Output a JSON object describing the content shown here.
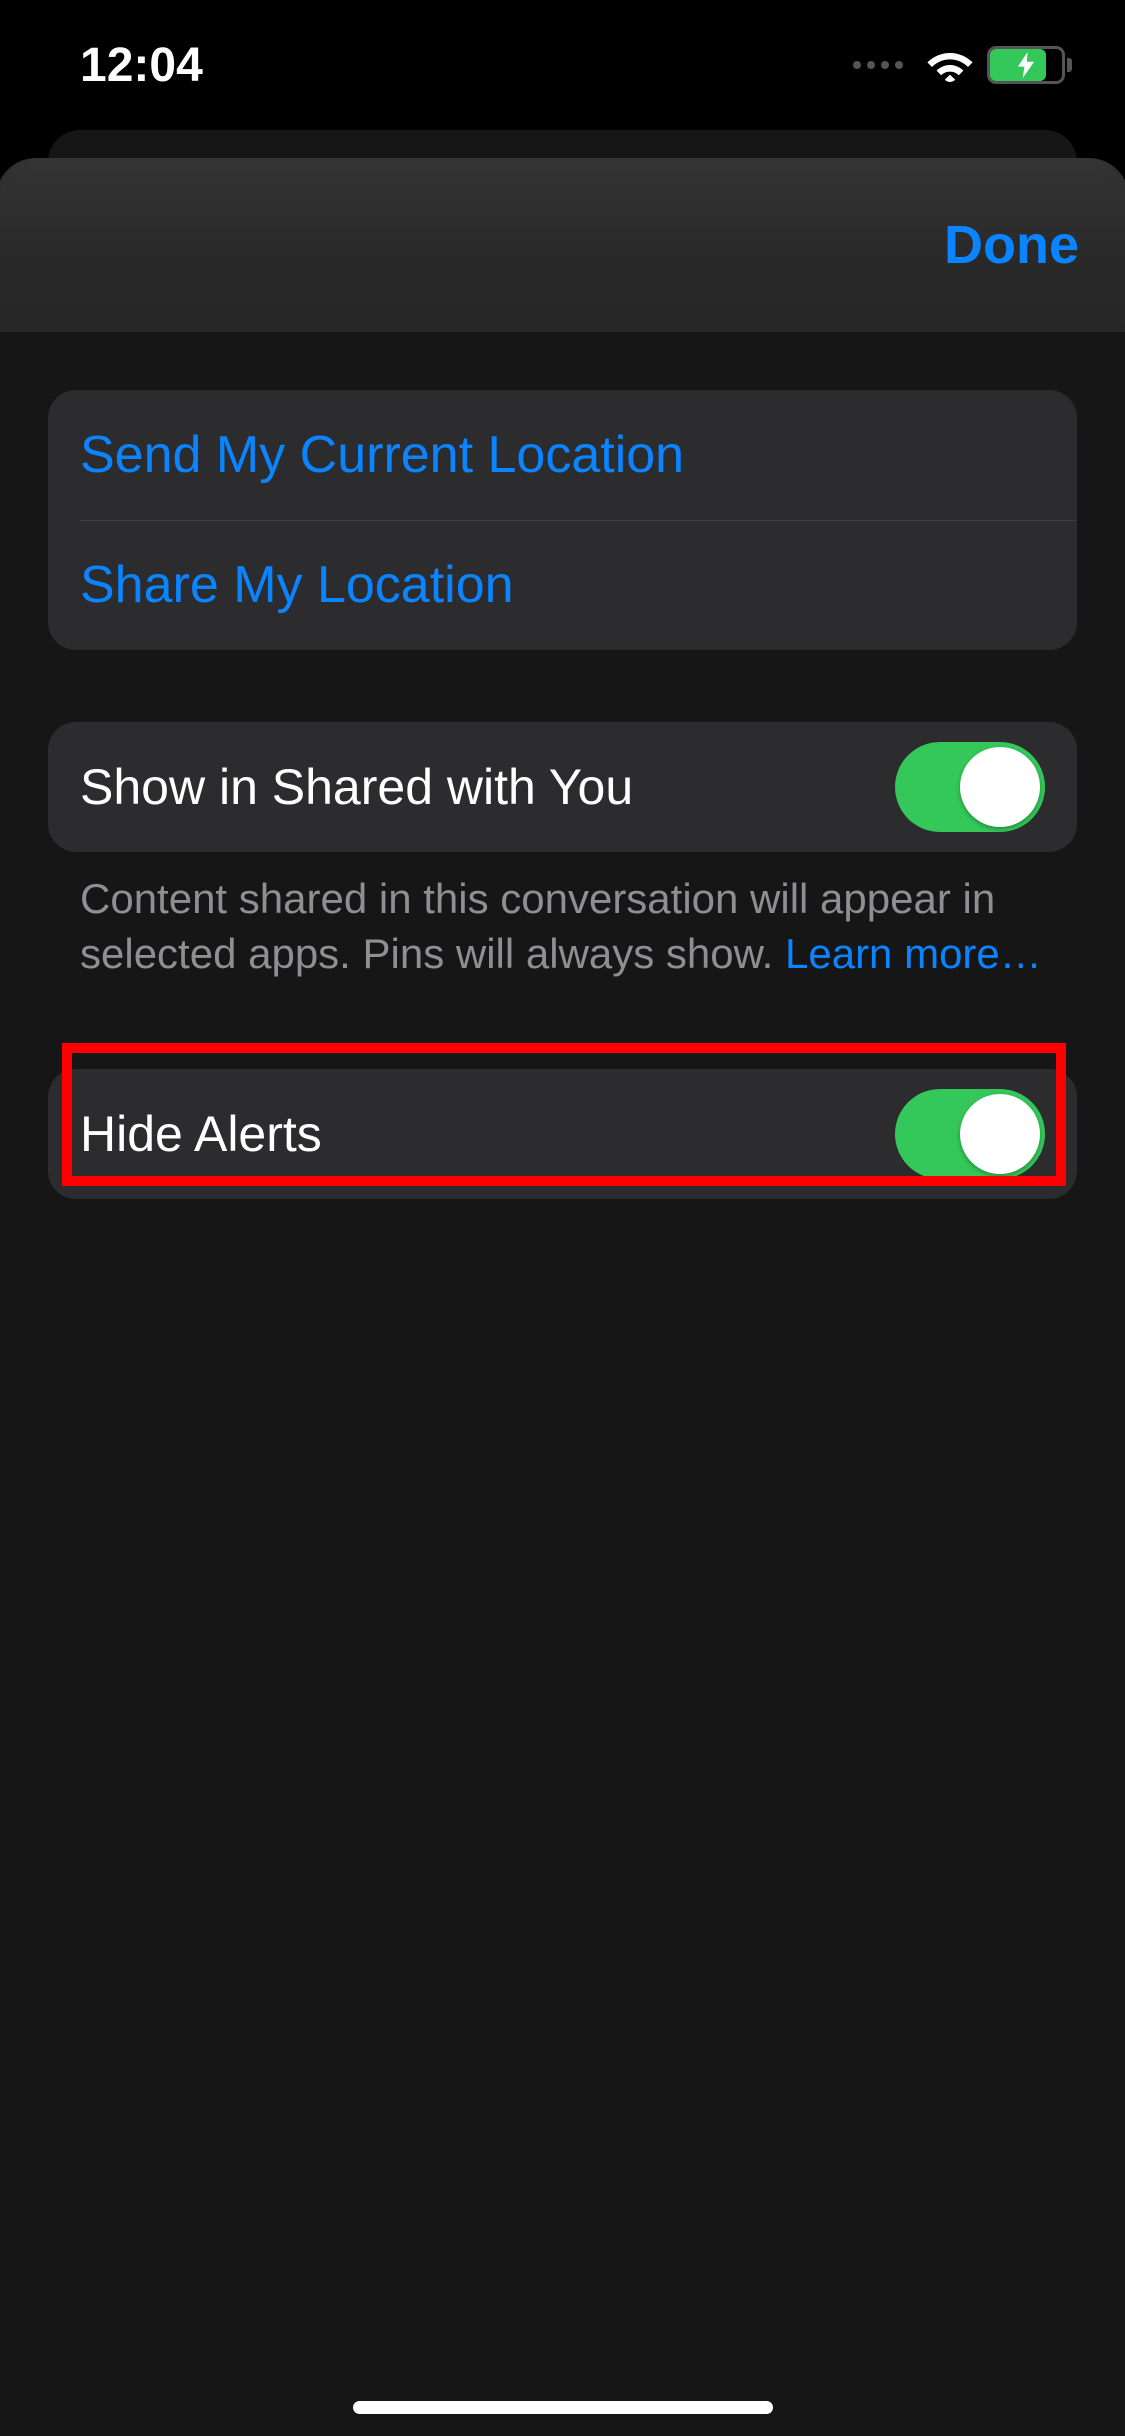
{
  "status": {
    "time": "12:04"
  },
  "nav": {
    "done": "Done"
  },
  "location_group": {
    "send": "Send My Current Location",
    "share": "Share My Location"
  },
  "shared_group": {
    "label": "Show in Shared with You",
    "toggle_on": true
  },
  "shared_footer": {
    "text": "Content shared in this conversation will appear in selected apps. Pins will always show. ",
    "link": "Learn more…"
  },
  "alerts_group": {
    "label": "Hide Alerts",
    "toggle_on": true
  }
}
